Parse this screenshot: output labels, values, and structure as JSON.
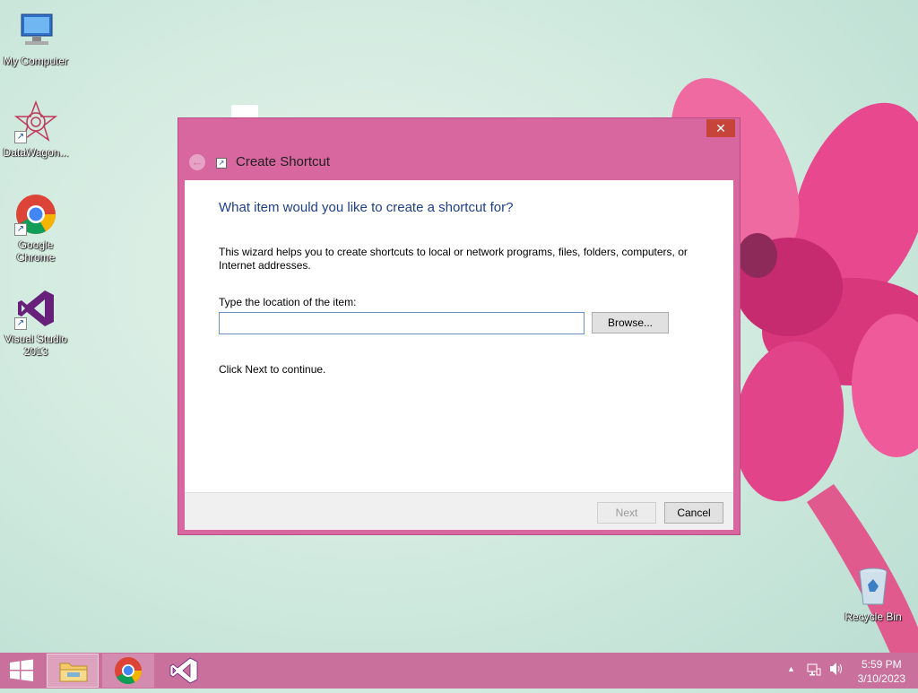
{
  "desktop": {
    "icons": [
      {
        "label": "My Computer"
      },
      {
        "label": "DataWagon..."
      },
      {
        "label": "Google Chrome"
      },
      {
        "label": "Visual Studio 2013"
      },
      {
        "label": "Recycle Bin"
      }
    ]
  },
  "dialog": {
    "title": "Create Shortcut",
    "close_glyph": "✕",
    "back_glyph": "←",
    "heading": "What item would you like to create a shortcut for?",
    "description": "This wizard helps you to create shortcuts to local or network programs, files, folders, computers, or Internet addresses.",
    "location_label": "Type the location of the item:",
    "location_value": "",
    "browse_label": "Browse...",
    "continue_text": "Click Next to continue.",
    "next_label": "Next",
    "cancel_label": "Cancel"
  },
  "taskbar": {
    "tray_up": "▲",
    "time": "5:59 PM",
    "date": "3/10/2023"
  },
  "colors": {
    "accent": "#d8669f",
    "taskbar": "#c9709c",
    "close": "#c7443a",
    "heading": "#1e3f8a"
  }
}
